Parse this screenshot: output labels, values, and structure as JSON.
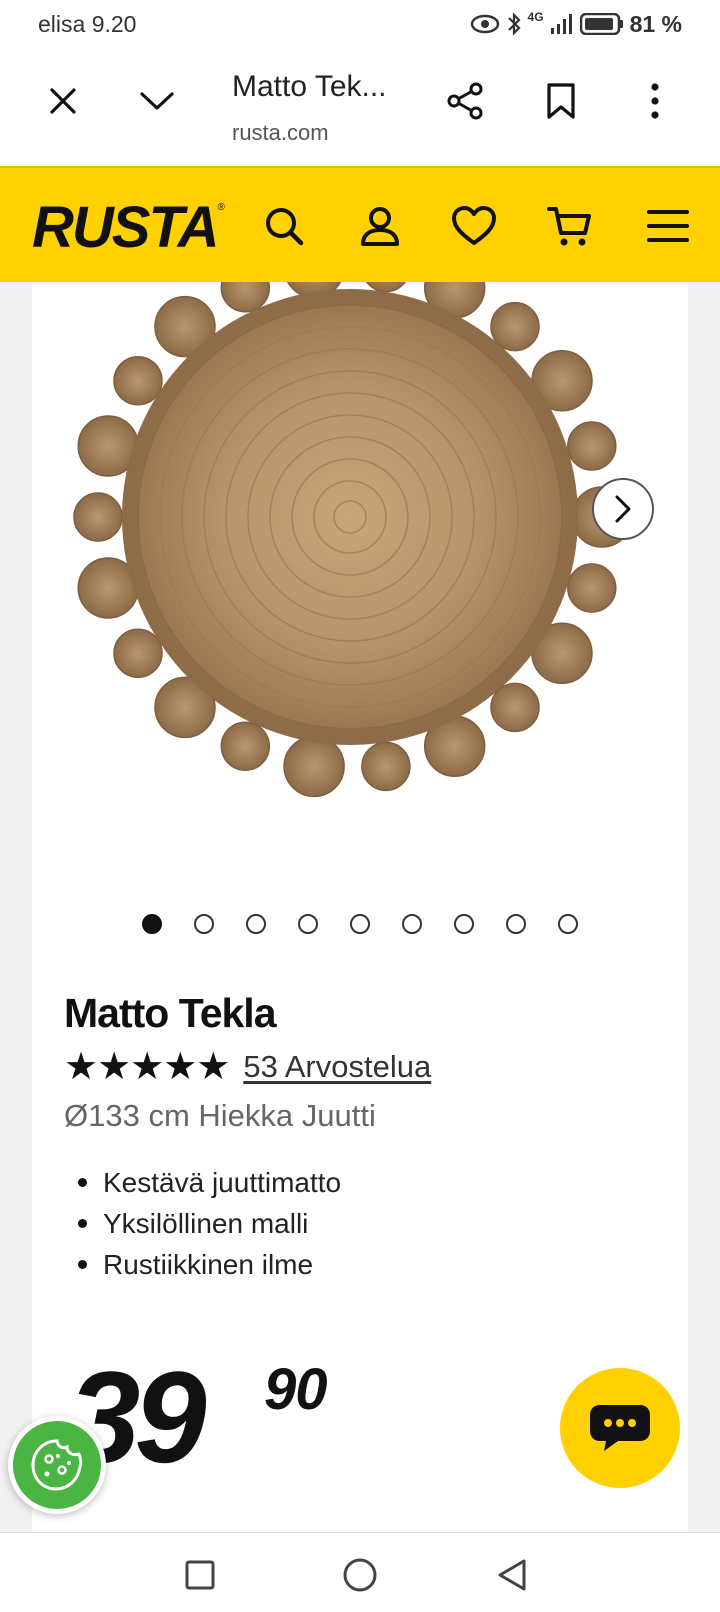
{
  "status_bar": {
    "carrier_time": "elisa 9.20",
    "network": "4G",
    "battery": "81 %",
    "icons": [
      "eye-icon",
      "bluetooth-icon",
      "signal-icon",
      "battery-icon"
    ]
  },
  "browser": {
    "tab_title": "Matto Tek...",
    "domain": "rusta.com",
    "icons": [
      "close-icon",
      "chevron-down-icon",
      "share-icon",
      "bookmark-icon",
      "more-vert-icon"
    ]
  },
  "site_header": {
    "logo": "RUSTA",
    "logo_mark": "®",
    "icons": [
      "search-icon",
      "account-icon",
      "heart-icon",
      "cart-icon",
      "menu-icon"
    ]
  },
  "gallery": {
    "dot_count": 9,
    "active_index": 0
  },
  "product": {
    "title": "Matto Tekla",
    "stars": "★★★★★",
    "rating": 5,
    "reviews": "53 Arvostelua",
    "variant": "Ø133 cm Hiekka Juutti",
    "bullets": [
      "Kestävä juuttimatto",
      "Yksilöllinen malli",
      "Rustiikkinen ilme"
    ],
    "price_whole": "39",
    "price_cents": "90"
  },
  "colors": {
    "brand_yellow": "#ffd100",
    "cookie_green": "#4bb543",
    "text": "#111111"
  }
}
